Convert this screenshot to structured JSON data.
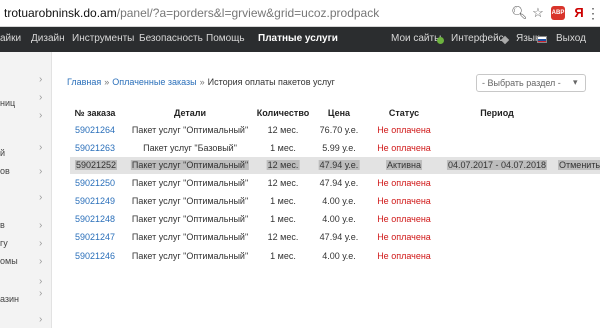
{
  "browser": {
    "url_domain": "trotuarobninsk.do.am",
    "url_path": "/panel/?a=porders&l=grview&grid=ucoz.prodpack",
    "adblock_label": "ABP",
    "yandex_label": "Я"
  },
  "topnav": {
    "left": [
      "айки",
      "Дизайн",
      "Инструменты",
      "Безопасность",
      "Помощь",
      "Платные услуги"
    ],
    "right": [
      "Мои сайты",
      "Интерфейс",
      "Язык",
      "Выход"
    ]
  },
  "sidebar": {
    "items": [
      "",
      "",
      "ниц",
      "",
      "й",
      "ов",
      "",
      "в",
      "гу",
      "омы",
      "",
      "азин",
      ""
    ]
  },
  "breadcrumb": {
    "home": "Главная",
    "paid_orders": "Оплаченные заказы",
    "sep": "»",
    "current": "История оплаты пакетов услуг"
  },
  "section_select": {
    "value": "- Выбрать раздел -"
  },
  "table": {
    "headers": [
      "№ заказа",
      "Детали",
      "Количество",
      "Цена",
      "Статус",
      "Период"
    ],
    "rows": [
      {
        "order": "59021264",
        "details": "Пакет услуг \"Оптимальный\"",
        "qty": "12 мес.",
        "price": "76.70 у.е.",
        "status": "Не оплачена",
        "period": "",
        "action": ""
      },
      {
        "order": "59021263",
        "details": "Пакет услуг \"Базовый\"",
        "qty": "1 мес.",
        "price": "5.99 у.е.",
        "status": "Не оплачена",
        "period": "",
        "action": ""
      },
      {
        "order": "59021252",
        "details": "Пакет услуг \"Оптимальный\"",
        "qty": "12 мес.",
        "price": "47.94 у.е.",
        "status": "Активна",
        "period": "04.07.2017 - 04.07.2018",
        "action": "Отменить"
      },
      {
        "order": "59021250",
        "details": "Пакет услуг \"Оптимальный\"",
        "qty": "12 мес.",
        "price": "47.94 у.е.",
        "status": "Не оплачена",
        "period": "",
        "action": ""
      },
      {
        "order": "59021249",
        "details": "Пакет услуг \"Оптимальный\"",
        "qty": "1 мес.",
        "price": "4.00 у.е.",
        "status": "Не оплачена",
        "period": "",
        "action": ""
      },
      {
        "order": "59021248",
        "details": "Пакет услуг \"Оптимальный\"",
        "qty": "1 мес.",
        "price": "4.00 у.е.",
        "status": "Не оплачена",
        "period": "",
        "action": ""
      },
      {
        "order": "59021247",
        "details": "Пакет услуг \"Оптимальный\"",
        "qty": "12 мес.",
        "price": "47.94 у.е.",
        "status": "Не оплачена",
        "period": "",
        "action": ""
      },
      {
        "order": "59021246",
        "details": "Пакет услуг \"Оптимальный\"",
        "qty": "1 мес.",
        "price": "4.00 у.е.",
        "status": "Не оплачена",
        "period": "",
        "action": ""
      }
    ]
  },
  "colors": {
    "nav_bg": "#2b2d2f",
    "link": "#2a6fba",
    "unpaid": "#d01818",
    "highlight_row": "#e3e3e3"
  }
}
